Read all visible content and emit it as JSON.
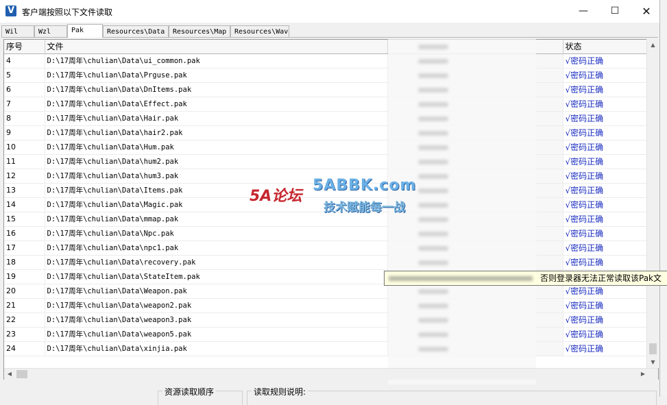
{
  "window": {
    "title": "客户端按照以下文件读取",
    "app_icon": "V"
  },
  "tabs": [
    {
      "label": "Wil",
      "active": false
    },
    {
      "label": "Wzl",
      "active": false
    },
    {
      "label": "Pak",
      "active": true
    },
    {
      "label": "Resources\\Data",
      "active": false
    },
    {
      "label": "Resources\\Map",
      "active": false
    },
    {
      "label": "Resources\\Wav",
      "active": false
    }
  ],
  "table": {
    "headers": {
      "index": "序号",
      "file": "文件",
      "status": "状态"
    },
    "rows": [
      {
        "index": "4",
        "file": "D:\\17周年\\chulian\\Data\\ui_common.pak",
        "status": "√密码正确"
      },
      {
        "index": "5",
        "file": "D:\\17周年\\chulian\\Data\\Prguse.pak",
        "status": "√密码正确"
      },
      {
        "index": "6",
        "file": "D:\\17周年\\chulian\\Data\\DnItems.pak",
        "status": "√密码正确"
      },
      {
        "index": "7",
        "file": "D:\\17周年\\chulian\\Data\\Effect.pak",
        "status": "√密码正确"
      },
      {
        "index": "8",
        "file": "D:\\17周年\\chulian\\Data\\Hair.pak",
        "status": "√密码正确"
      },
      {
        "index": "9",
        "file": "D:\\17周年\\chulian\\Data\\hair2.pak",
        "status": "√密码正确"
      },
      {
        "index": "10",
        "file": "D:\\17周年\\chulian\\Data\\Hum.pak",
        "status": "√密码正确"
      },
      {
        "index": "11",
        "file": "D:\\17周年\\chulian\\Data\\hum2.pak",
        "status": "√密码正确"
      },
      {
        "index": "12",
        "file": "D:\\17周年\\chulian\\Data\\hum3.pak",
        "status": "√密码正确"
      },
      {
        "index": "13",
        "file": "D:\\17周年\\chulian\\Data\\Items.pak",
        "status": "√密码正确"
      },
      {
        "index": "14",
        "file": "D:\\17周年\\chulian\\Data\\Magic.pak",
        "status": "√密码正确"
      },
      {
        "index": "15",
        "file": "D:\\17周年\\chulian\\Data\\mmap.pak",
        "status": "√密码正确"
      },
      {
        "index": "16",
        "file": "D:\\17周年\\chulian\\Data\\Npc.pak",
        "status": "√密码正确"
      },
      {
        "index": "17",
        "file": "D:\\17周年\\chulian\\Data\\npc1.pak",
        "status": "√密码正确"
      },
      {
        "index": "18",
        "file": "D:\\17周年\\chulian\\Data\\recovery.pak",
        "status": "√密码正确"
      },
      {
        "index": "19",
        "file": "D:\\17周年\\chulian\\Data\\StateItem.pak",
        "status": "√密码正确"
      },
      {
        "index": "20",
        "file": "D:\\17周年\\chulian\\Data\\Weapon.pak",
        "status": "√密码正确"
      },
      {
        "index": "21",
        "file": "D:\\17周年\\chulian\\Data\\weapon2.pak",
        "status": "√密码正确"
      },
      {
        "index": "22",
        "file": "D:\\17周年\\chulian\\Data\\weapon3.pak",
        "status": "√密码正确"
      },
      {
        "index": "23",
        "file": "D:\\17周年\\chulian\\Data\\weapon5.pak",
        "status": "√密码正确"
      },
      {
        "index": "24",
        "file": "D:\\17周年\\chulian\\Data\\xinjia.pak",
        "status": "√密码正确"
      }
    ]
  },
  "tooltip": {
    "text": "否则登录器无法正常读取该Pak文件"
  },
  "watermark": {
    "logo": "5A论坛",
    "site": "5ABBK.com",
    "slogan": "技术赋能每一战"
  },
  "bottom": {
    "resource_order_label": "资源读取顺序",
    "rules_label": "读取规则说明:"
  },
  "colors": {
    "status_text": "#1a2cc0",
    "tooltip_bg": "#ffffe1",
    "watermark_logo": "#c6262e",
    "watermark_site": "#6ab0e6"
  },
  "icons": {
    "minimize": "minimize-icon",
    "maximize": "maximize-icon",
    "close": "close-icon",
    "scroll_up": "chevron-up-icon",
    "scroll_down": "chevron-down-icon",
    "scroll_left": "chevron-left-icon",
    "scroll_right": "chevron-right-icon"
  }
}
